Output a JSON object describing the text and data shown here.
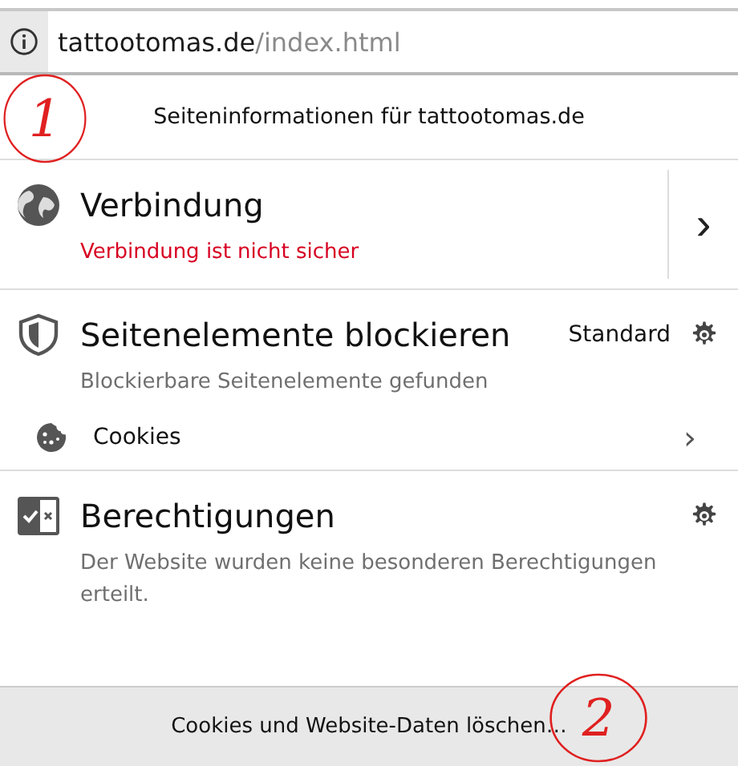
{
  "address_bar": {
    "domain": "tattootomas.de",
    "path": "/index.html"
  },
  "panel_title": "Seiteninformationen für tattootomas.de",
  "connection": {
    "title": "Verbindung",
    "status": "Verbindung ist nicht sicher",
    "secure": false,
    "arrow": "›"
  },
  "content_blocking": {
    "title": "Seitenelemente blockieren",
    "mode": "Standard",
    "subtitle": "Blockierbare Seitenelemente gefunden",
    "items": [
      {
        "label": "Cookies",
        "arrow": "›"
      }
    ]
  },
  "permissions": {
    "title": "Berechtigungen",
    "subtitle": "Der Website wurden keine besonderen Berechtigungen erteilt."
  },
  "footer_button": "Cookies und Website-Daten löschen…",
  "annotations": [
    {
      "label": "1"
    },
    {
      "label": "2"
    }
  ]
}
